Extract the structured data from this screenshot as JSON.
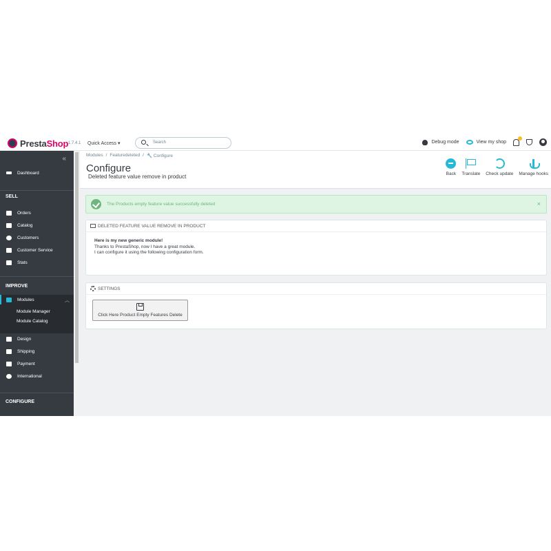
{
  "app": {
    "logo": "PrestaShop",
    "version": "1.7.4.1"
  },
  "header": {
    "quick_access": "Quick Access",
    "search_placeholder": "Search",
    "debug_mode": "Debug mode",
    "view_my_shop": "View my shop"
  },
  "sidebar": {
    "dashboard": "Dashboard",
    "sections": {
      "sell": "SELL",
      "improve": "IMPROVE",
      "configure": "CONFIGURE"
    },
    "sell_items": [
      "Orders",
      "Catalog",
      "Customers",
      "Customer Service",
      "Stats"
    ],
    "modules": "Modules",
    "modules_sub": [
      "Module Manager",
      "Module Catalog"
    ],
    "improve_items": [
      "Design",
      "Shipping",
      "Payment",
      "International"
    ]
  },
  "breadcrumb": [
    "Modules",
    "/",
    "Featuredeleted",
    "/",
    "Configure"
  ],
  "page": {
    "title": "Configure",
    "subtitle": "Deleted feature value remove in product"
  },
  "toolbar": {
    "back": "Back",
    "translate": "Translate",
    "check_update": "Check update",
    "manage_hooks": "Manage hooks"
  },
  "alert": {
    "message": "The Products empty feature value successfully deleted",
    "close": "×"
  },
  "info_panel": {
    "heading": "DELETED FEATURE VALUE REMOVE IN PRODUCT",
    "title": "Here is my new generic module!",
    "line1": "Thanks to PrestaShop, now I have a great module.",
    "line2": "I can configure it using the following configuration form."
  },
  "settings_panel": {
    "heading": "SETTINGS",
    "button_label": "Click Here Product Empty Features Delete"
  },
  "colors": {
    "accent": "#25b9d7",
    "sidebar": "#363a41",
    "success": "#70b580",
    "brand_pink": "#df0067"
  }
}
